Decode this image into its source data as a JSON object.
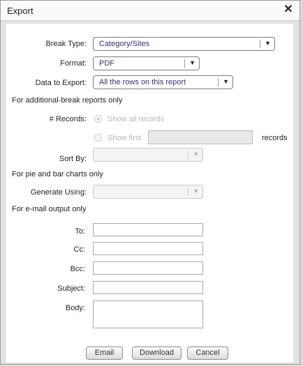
{
  "dialog": {
    "title": "Export",
    "close_icon": "close-icon"
  },
  "form": {
    "break_type": {
      "label": "Break Type:",
      "value": "Category/Sites"
    },
    "format": {
      "label": "Format:",
      "value": "PDF"
    },
    "data_to_export": {
      "label": "Data to Export:",
      "value": "All the rows on this report"
    },
    "section_additional_break": "For additional-break reports only",
    "records": {
      "label": "# Records:",
      "option_all": "Show all records",
      "option_first": "Show first",
      "suffix": "records"
    },
    "sort_by": {
      "label": "Sort By:",
      "value": ""
    },
    "section_charts": "For pie and bar charts only",
    "generate_using": {
      "label": "Generate Using:",
      "value": ""
    },
    "section_email": "For e-mail output only",
    "to": {
      "label": "To:",
      "value": ""
    },
    "cc": {
      "label": "Cc:",
      "value": ""
    },
    "bcc": {
      "label": "Bcc:",
      "value": ""
    },
    "subject": {
      "label": "Subject:",
      "value": ""
    },
    "body": {
      "label": "Body:",
      "value": ""
    }
  },
  "buttons": {
    "email": "Email",
    "download": "Download",
    "cancel": "Cancel"
  },
  "icons": {
    "dropdown": "chevron-down-icon",
    "radio_selected": "radio-selected-icon"
  }
}
